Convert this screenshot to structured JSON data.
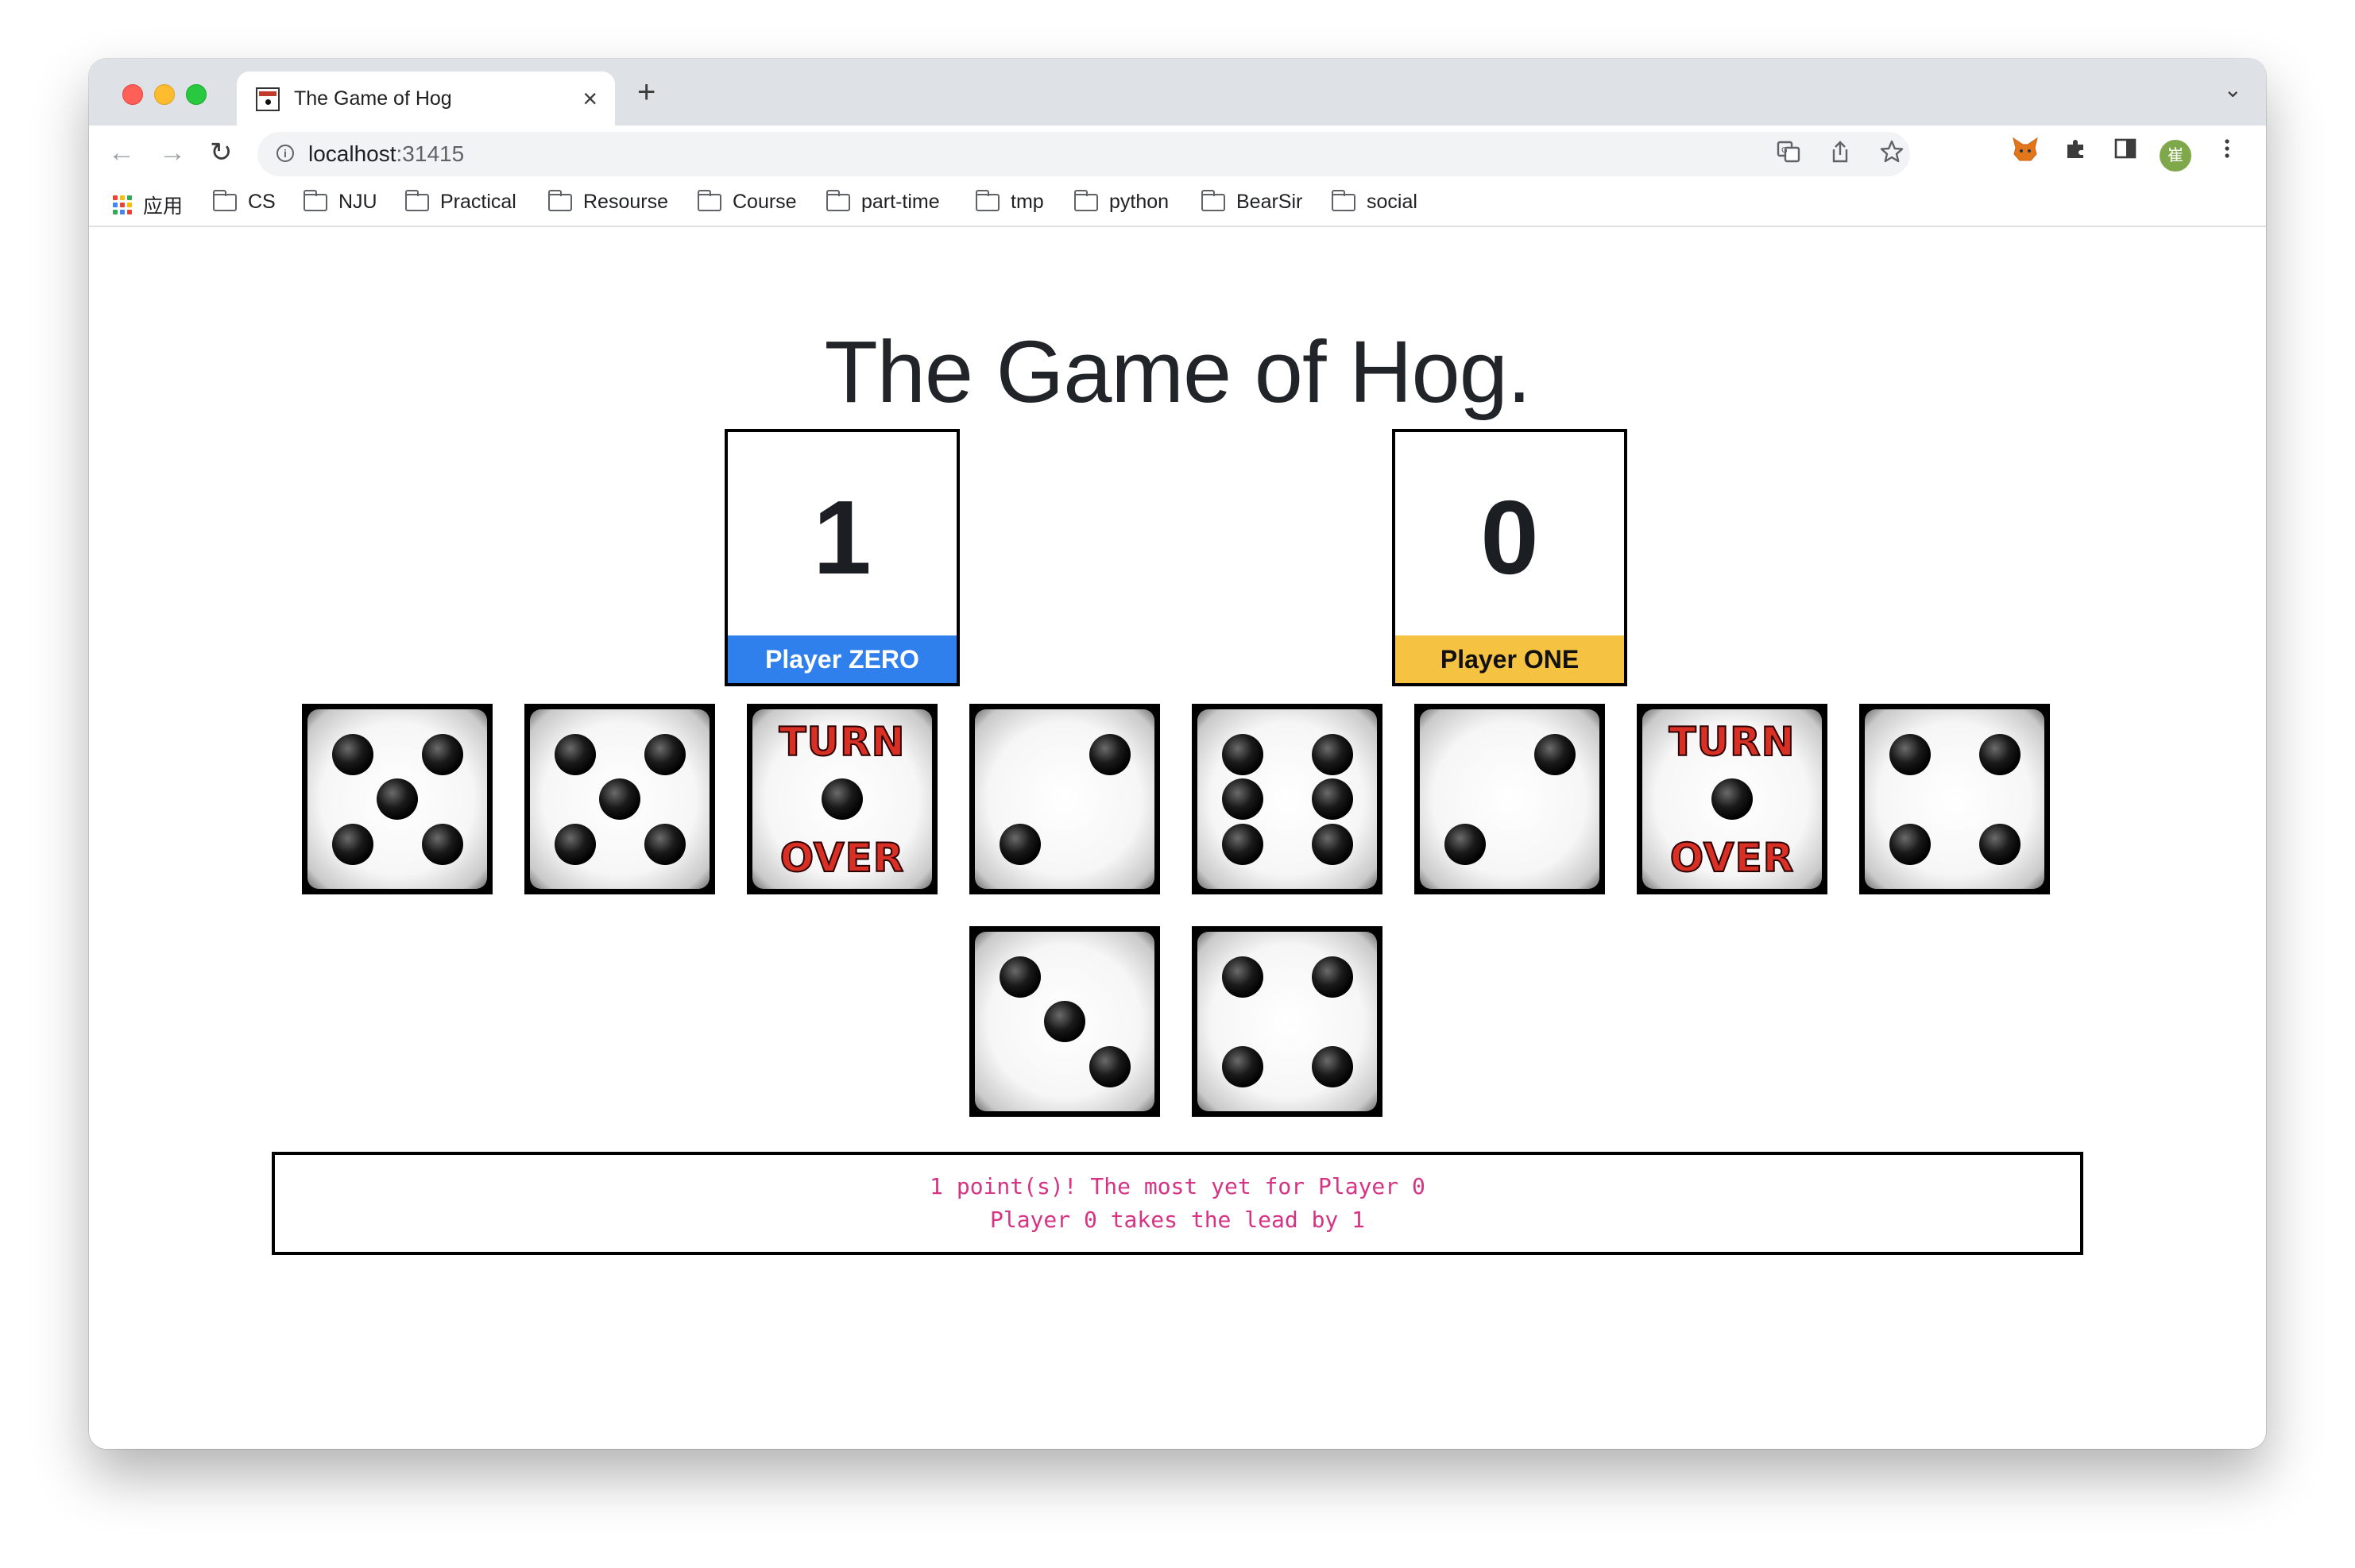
{
  "browser": {
    "tab_title": "The Game of Hog",
    "tab_close": "×",
    "new_tab": "+",
    "tab_menu": "⌄",
    "back": "←",
    "forward": "→",
    "reload": "↻",
    "url_host": "localhost",
    "url_port": ":31415",
    "bookmarks": {
      "apps": "应用",
      "items": [
        "CS",
        "NJU",
        "Practical",
        "Resourse",
        "Course",
        "part-time",
        "tmp",
        "python",
        "BearSir",
        "social"
      ]
    },
    "avatar_text": "崔"
  },
  "page": {
    "title": "The Game of Hog."
  },
  "players": [
    {
      "label": "Player ZERO",
      "score": "1",
      "color": "#2f80ed"
    },
    {
      "label": "Player ONE",
      "score": "0",
      "color": "#f5c242"
    }
  ],
  "dice": {
    "row1": [
      5,
      5,
      "turn-over",
      2,
      6,
      2,
      "turn-over",
      4
    ],
    "row2": [
      3,
      4
    ],
    "turn_over_top": "TURN",
    "turn_over_bottom": "OVER"
  },
  "messages": {
    "line1": "1 point(s)! The most yet for Player 0",
    "line2": "Player 0 takes the lead by 1",
    "color": "#d63384"
  }
}
